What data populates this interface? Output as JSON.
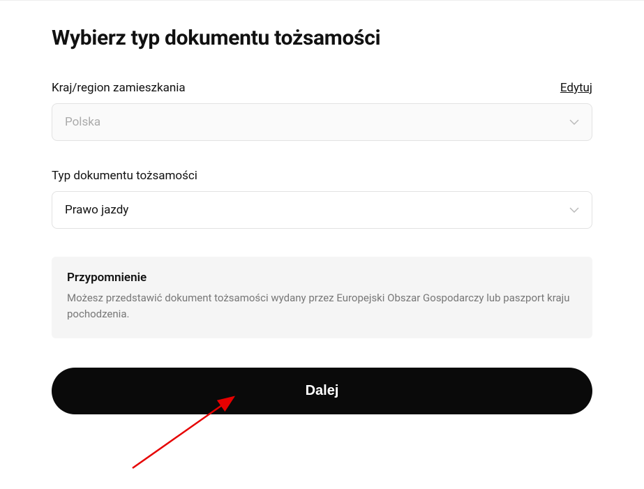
{
  "title": "Wybierz typ dokumentu tożsamości",
  "country": {
    "label": "Kraj/region zamieszkania",
    "editLabel": "Edytuj",
    "value": "Polska"
  },
  "docType": {
    "label": "Typ dokumentu tożsamości",
    "value": "Prawo jazdy"
  },
  "reminder": {
    "title": "Przypomnienie",
    "text": "Możesz przedstawić dokument tożsamości wydany przez Europejski Obszar Gospodarczy lub paszport kraju pochodzenia."
  },
  "nextButton": "Dalej"
}
